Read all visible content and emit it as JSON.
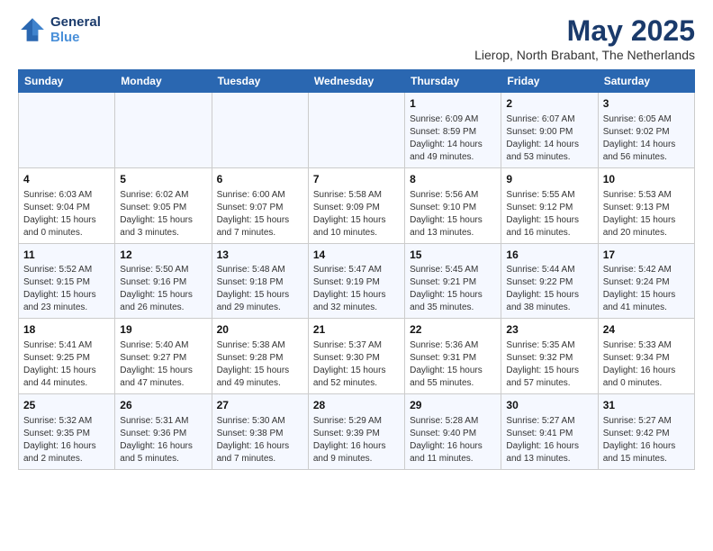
{
  "header": {
    "logo_line1": "General",
    "logo_line2": "Blue",
    "month": "May 2025",
    "location": "Lierop, North Brabant, The Netherlands"
  },
  "weekdays": [
    "Sunday",
    "Monday",
    "Tuesday",
    "Wednesday",
    "Thursday",
    "Friday",
    "Saturday"
  ],
  "weeks": [
    [
      {
        "day": "",
        "info": ""
      },
      {
        "day": "",
        "info": ""
      },
      {
        "day": "",
        "info": ""
      },
      {
        "day": "",
        "info": ""
      },
      {
        "day": "1",
        "info": "Sunrise: 6:09 AM\nSunset: 8:59 PM\nDaylight: 14 hours\nand 49 minutes."
      },
      {
        "day": "2",
        "info": "Sunrise: 6:07 AM\nSunset: 9:00 PM\nDaylight: 14 hours\nand 53 minutes."
      },
      {
        "day": "3",
        "info": "Sunrise: 6:05 AM\nSunset: 9:02 PM\nDaylight: 14 hours\nand 56 minutes."
      }
    ],
    [
      {
        "day": "4",
        "info": "Sunrise: 6:03 AM\nSunset: 9:04 PM\nDaylight: 15 hours\nand 0 minutes."
      },
      {
        "day": "5",
        "info": "Sunrise: 6:02 AM\nSunset: 9:05 PM\nDaylight: 15 hours\nand 3 minutes."
      },
      {
        "day": "6",
        "info": "Sunrise: 6:00 AM\nSunset: 9:07 PM\nDaylight: 15 hours\nand 7 minutes."
      },
      {
        "day": "7",
        "info": "Sunrise: 5:58 AM\nSunset: 9:09 PM\nDaylight: 15 hours\nand 10 minutes."
      },
      {
        "day": "8",
        "info": "Sunrise: 5:56 AM\nSunset: 9:10 PM\nDaylight: 15 hours\nand 13 minutes."
      },
      {
        "day": "9",
        "info": "Sunrise: 5:55 AM\nSunset: 9:12 PM\nDaylight: 15 hours\nand 16 minutes."
      },
      {
        "day": "10",
        "info": "Sunrise: 5:53 AM\nSunset: 9:13 PM\nDaylight: 15 hours\nand 20 minutes."
      }
    ],
    [
      {
        "day": "11",
        "info": "Sunrise: 5:52 AM\nSunset: 9:15 PM\nDaylight: 15 hours\nand 23 minutes."
      },
      {
        "day": "12",
        "info": "Sunrise: 5:50 AM\nSunset: 9:16 PM\nDaylight: 15 hours\nand 26 minutes."
      },
      {
        "day": "13",
        "info": "Sunrise: 5:48 AM\nSunset: 9:18 PM\nDaylight: 15 hours\nand 29 minutes."
      },
      {
        "day": "14",
        "info": "Sunrise: 5:47 AM\nSunset: 9:19 PM\nDaylight: 15 hours\nand 32 minutes."
      },
      {
        "day": "15",
        "info": "Sunrise: 5:45 AM\nSunset: 9:21 PM\nDaylight: 15 hours\nand 35 minutes."
      },
      {
        "day": "16",
        "info": "Sunrise: 5:44 AM\nSunset: 9:22 PM\nDaylight: 15 hours\nand 38 minutes."
      },
      {
        "day": "17",
        "info": "Sunrise: 5:42 AM\nSunset: 9:24 PM\nDaylight: 15 hours\nand 41 minutes."
      }
    ],
    [
      {
        "day": "18",
        "info": "Sunrise: 5:41 AM\nSunset: 9:25 PM\nDaylight: 15 hours\nand 44 minutes."
      },
      {
        "day": "19",
        "info": "Sunrise: 5:40 AM\nSunset: 9:27 PM\nDaylight: 15 hours\nand 47 minutes."
      },
      {
        "day": "20",
        "info": "Sunrise: 5:38 AM\nSunset: 9:28 PM\nDaylight: 15 hours\nand 49 minutes."
      },
      {
        "day": "21",
        "info": "Sunrise: 5:37 AM\nSunset: 9:30 PM\nDaylight: 15 hours\nand 52 minutes."
      },
      {
        "day": "22",
        "info": "Sunrise: 5:36 AM\nSunset: 9:31 PM\nDaylight: 15 hours\nand 55 minutes."
      },
      {
        "day": "23",
        "info": "Sunrise: 5:35 AM\nSunset: 9:32 PM\nDaylight: 15 hours\nand 57 minutes."
      },
      {
        "day": "24",
        "info": "Sunrise: 5:33 AM\nSunset: 9:34 PM\nDaylight: 16 hours\nand 0 minutes."
      }
    ],
    [
      {
        "day": "25",
        "info": "Sunrise: 5:32 AM\nSunset: 9:35 PM\nDaylight: 16 hours\nand 2 minutes."
      },
      {
        "day": "26",
        "info": "Sunrise: 5:31 AM\nSunset: 9:36 PM\nDaylight: 16 hours\nand 5 minutes."
      },
      {
        "day": "27",
        "info": "Sunrise: 5:30 AM\nSunset: 9:38 PM\nDaylight: 16 hours\nand 7 minutes."
      },
      {
        "day": "28",
        "info": "Sunrise: 5:29 AM\nSunset: 9:39 PM\nDaylight: 16 hours\nand 9 minutes."
      },
      {
        "day": "29",
        "info": "Sunrise: 5:28 AM\nSunset: 9:40 PM\nDaylight: 16 hours\nand 11 minutes."
      },
      {
        "day": "30",
        "info": "Sunrise: 5:27 AM\nSunset: 9:41 PM\nDaylight: 16 hours\nand 13 minutes."
      },
      {
        "day": "31",
        "info": "Sunrise: 5:27 AM\nSunset: 9:42 PM\nDaylight: 16 hours\nand 15 minutes."
      }
    ]
  ]
}
